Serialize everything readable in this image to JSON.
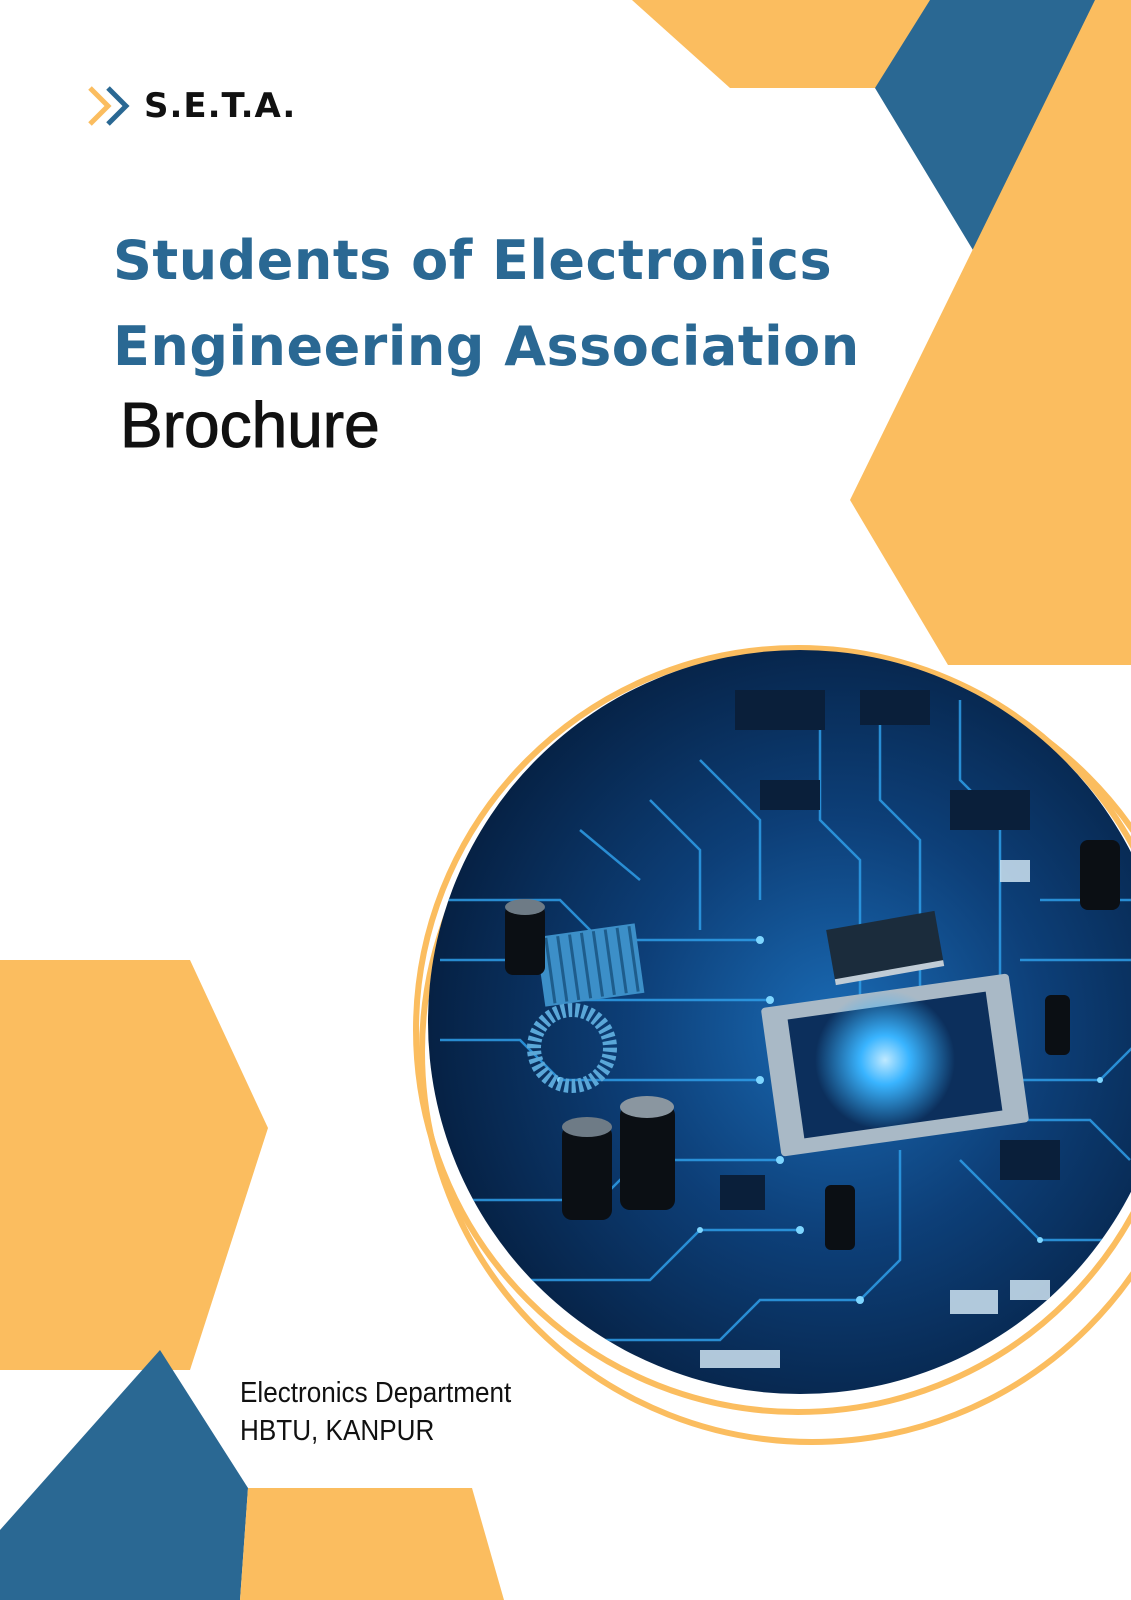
{
  "logo": {
    "text": "S.E.T.A.",
    "icon": "double-chevron-icon"
  },
  "headline": {
    "line1": "Students of Electronics",
    "line2": "Engineering Association"
  },
  "subtitle": "Brochure",
  "footer": {
    "line1": "Electronics Department",
    "line2": "HBTU, KANPUR"
  },
  "image": {
    "subject": "circuit-board-photo"
  },
  "colors": {
    "accent_yellow": "#fbbd5f",
    "accent_blue": "#2a6893",
    "board_dark": "#062044",
    "trace_glow": "#36b6ff"
  }
}
